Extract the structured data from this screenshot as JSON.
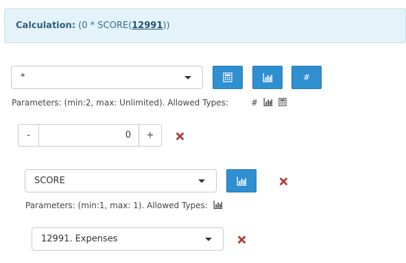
{
  "calculation": {
    "label": "Calculation:",
    "expr_prefix": " (0 * SCORE(",
    "expr_id": "12991",
    "expr_suffix": "))"
  },
  "operator": {
    "selected": "*",
    "params_text": "Parameters: (min:2, max: Unlimited). Allowed Types:",
    "buttons": [
      {
        "icon": "calculator-icon"
      },
      {
        "icon": "bar-chart-icon"
      },
      {
        "label": "#"
      }
    ],
    "allowed_type_icons": [
      "hash-icon",
      "bar-chart-icon",
      "calculator-icon"
    ],
    "hash_glyph": "#"
  },
  "number_param": {
    "minus_label": "-",
    "value": "0",
    "plus_label": "+"
  },
  "score_function": {
    "selected": "SCORE",
    "params_text": "Parameters: (min:1, max: 1). Allowed Types:",
    "allowed_type_icons": [
      "bar-chart-icon"
    ]
  },
  "score_param": {
    "selected": "12991. Expenses"
  },
  "colors": {
    "accent": "#2f8fd1",
    "remove": "#b0413e",
    "banner_bg": "#e4f3f9"
  }
}
